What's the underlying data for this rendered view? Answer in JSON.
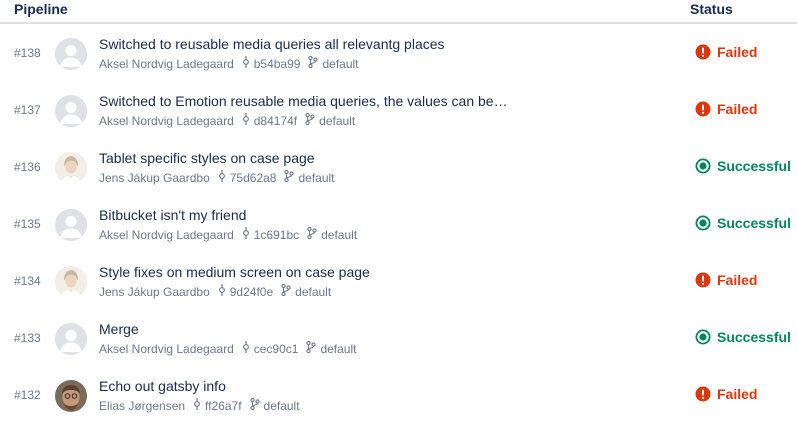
{
  "header": {
    "pipeline_label": "Pipeline",
    "status_label": "Status"
  },
  "colors": {
    "failed": "#DE350B",
    "successful": "#00875A",
    "muted": "#6B778C",
    "text": "#172B4D"
  },
  "rows": [
    {
      "number": "#138",
      "title": "Switched to reusable media queries all relevantg places",
      "author": "Aksel Nordvig Ladegaard",
      "commit": "b54ba99",
      "branch": "default",
      "status": "Failed",
      "status_type": "failed",
      "avatar": "default-avatar-icon"
    },
    {
      "number": "#137",
      "title": "Switched to Emotion reusable media queries, the values can be…",
      "author": "Aksel Nordvig Ladegaard",
      "commit": "d84174f",
      "branch": "default",
      "status": "Failed",
      "status_type": "failed",
      "avatar": "default-avatar-icon"
    },
    {
      "number": "#136",
      "title": "Tablet specific styles on case page",
      "author": "Jens Jákup Gaardbo",
      "commit": "75d62a8",
      "branch": "default",
      "status": "Successful",
      "status_type": "successful",
      "avatar": "photo-avatar-jens"
    },
    {
      "number": "#135",
      "title": "Bitbucket isn't my friend",
      "author": "Aksel Nordvig Ladegaard",
      "commit": "1c691bc",
      "branch": "default",
      "status": "Successful",
      "status_type": "successful",
      "avatar": "default-avatar-icon"
    },
    {
      "number": "#134",
      "title": "Style fixes on medium screen on case page",
      "author": "Jens Jákup Gaardbo",
      "commit": "9d24f0e",
      "branch": "default",
      "status": "Failed",
      "status_type": "failed",
      "avatar": "photo-avatar-jens"
    },
    {
      "number": "#133",
      "title": "Merge",
      "author": "Aksel Nordvig Ladegaard",
      "commit": "cec90c1",
      "branch": "default",
      "status": "Successful",
      "status_type": "successful",
      "avatar": "default-avatar-icon"
    },
    {
      "number": "#132",
      "title": "Echo out gatsby info",
      "author": "Elias Jørgensen",
      "commit": "ff26a7f",
      "branch": "default",
      "status": "Failed",
      "status_type": "failed",
      "avatar": "photo-avatar-elias"
    }
  ]
}
